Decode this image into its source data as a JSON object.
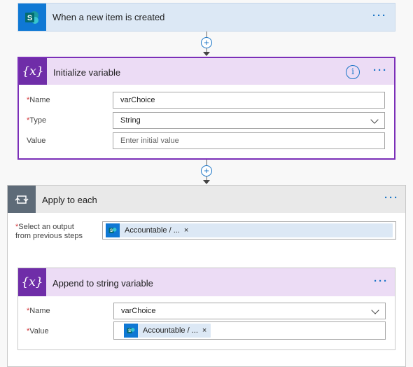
{
  "trigger": {
    "title": "When a new item is created",
    "icon": "sharepoint-icon",
    "more": "···",
    "tile_color": "#0f78d4"
  },
  "connector": {
    "plus": "+"
  },
  "init_variable": {
    "title": "Initialize variable",
    "icon": "variable-icon",
    "icon_glyph": "{x}",
    "info_glyph": "i",
    "more": "···",
    "accent": "#7b2fb8",
    "fields": {
      "name": {
        "label": "Name",
        "value": "varChoice",
        "required": true
      },
      "type": {
        "label": "Type",
        "value": "String",
        "required": true
      },
      "value": {
        "label": "Value",
        "placeholder": "Enter initial value",
        "required": false
      }
    }
  },
  "apply_each": {
    "title": "Apply to each",
    "icon": "loop-icon",
    "more": "···",
    "select_label_line1": "Select an output",
    "select_label_line2": "from previous steps",
    "token": {
      "text": "Accountable / ...",
      "close": "×",
      "icon": "sharepoint-icon"
    }
  },
  "append_var": {
    "title": "Append to string variable",
    "icon": "variable-icon",
    "icon_glyph": "{x}",
    "more": "···",
    "fields": {
      "name": {
        "label": "Name",
        "value": "varChoice",
        "required": true
      },
      "value": {
        "label": "Value",
        "required": true,
        "token": {
          "text": "Accountable / ...",
          "close": "×",
          "icon": "sharepoint-icon"
        }
      }
    }
  },
  "required_mark": "*"
}
